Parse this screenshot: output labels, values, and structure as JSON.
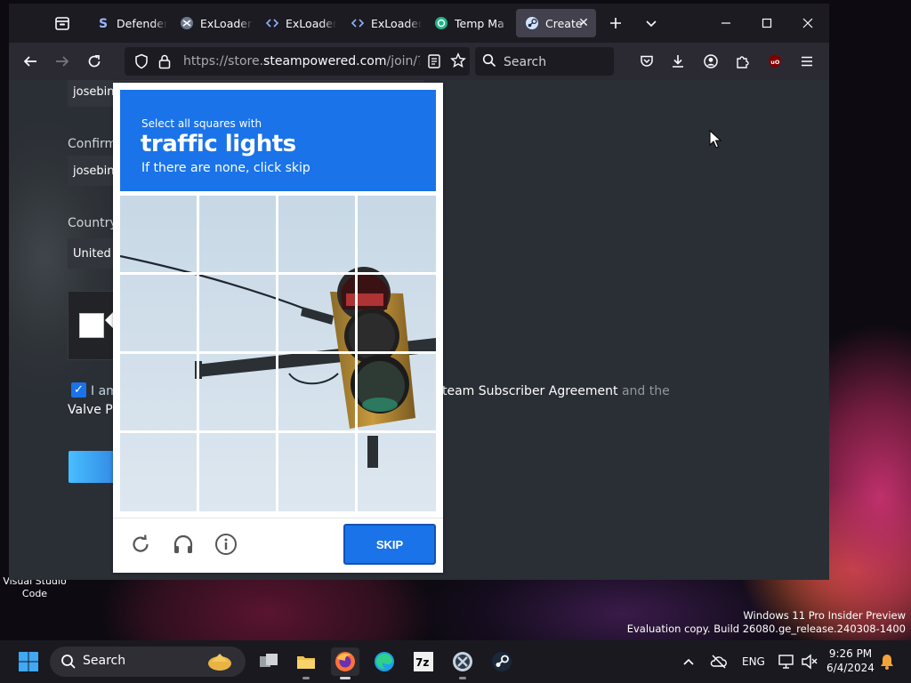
{
  "desktop": {
    "icon_label_line1": "Visual Studio",
    "icon_label_line2": "Code",
    "watermark_line1": "Windows 11 Pro Insider Preview",
    "watermark_line2": "Evaluation copy. Build 26080.ge_release.240308-1400"
  },
  "browser": {
    "tabs": [
      {
        "label": "Defender",
        "icon": "steam-s-icon",
        "active": false
      },
      {
        "label": "ExLoader |",
        "icon": "exloader-icon",
        "active": false
      },
      {
        "label": "ExLoader",
        "icon": "code-brackets-icon",
        "active": false
      },
      {
        "label": "ExLoader",
        "icon": "code-brackets-icon",
        "active": false
      },
      {
        "label": "Temp Ma",
        "icon": "temp-mail-icon",
        "active": false
      },
      {
        "label": "Create",
        "icon": "steam-icon",
        "active": true
      }
    ],
    "url_prefix": "https://store.",
    "url_domain": "steampowered.com",
    "url_suffix": "/join/?redir",
    "search_placeholder": "Search"
  },
  "page": {
    "email_value": "josebin",
    "confirm_label": "Confirm",
    "confirm_value": "josebin",
    "country_label": "Country",
    "country_value": "United",
    "agree_prefix": "I am",
    "agree_link": "team Subscriber Agreement",
    "agree_suffix": " and the",
    "agree_line2": "Valve Pr"
  },
  "captcha": {
    "prompt_line1": "Select all squares with",
    "prompt_target": "traffic lights",
    "prompt_line3": "If there are none, click skip",
    "skip_label": "SKIP",
    "grid_size": 4,
    "footer_icons": [
      "refresh-icon",
      "audio-headphones-icon",
      "info-icon"
    ]
  },
  "taskbar": {
    "search_label": "Search",
    "lang": "ENG",
    "time": "9:26 PM",
    "date": "6/4/2024"
  },
  "colors": {
    "captcha_blue": "#1a73e8",
    "browser_tabbar": "#1c1b22",
    "browser_navbar": "#2b2a33",
    "page_bg": "#2a2e35"
  }
}
